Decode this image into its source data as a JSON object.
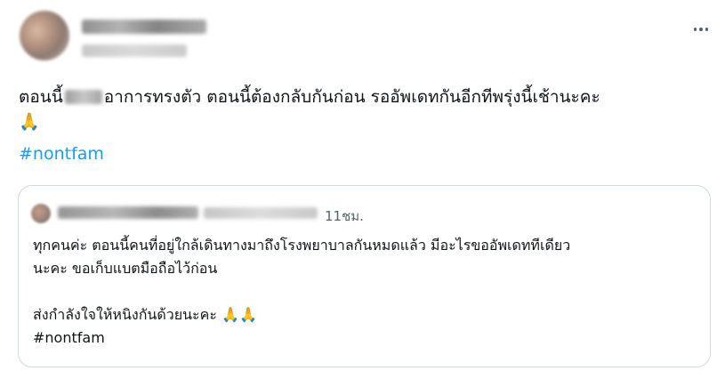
{
  "tweet": {
    "text_before": "ตอนนี้",
    "text_after": "อาการทรงตัว ตอนนี้ต้องกลับกันก่อน รออัพเดทกันอีกทีพรุ่งนี้เช้านะคะ",
    "emoji": "🙏",
    "hashtag": "#nontfam"
  },
  "quote": {
    "time": "11ชม.",
    "line1": "ทุกคนค่ะ ตอนนี้คนที่อยู่ใกล้เดินทางมาถึงโรงพยาบาลกันหมดแล้ว มีอะไรขออัพเดททีเดียว",
    "line2": "นะคะ ขอเก็บแบตมือถือไว้ก่อน",
    "line3": "ส่งกำลังใจให้หนิงกันด้วยนะคะ",
    "emoji": "🙏🙏",
    "hashtag": "#nontfam"
  },
  "colors": {
    "text": "#0f1419",
    "secondary": "#536471",
    "link": "#1d9bf0",
    "border": "#cfd9de"
  },
  "icons": {
    "more": "more-horizontal-icon"
  }
}
